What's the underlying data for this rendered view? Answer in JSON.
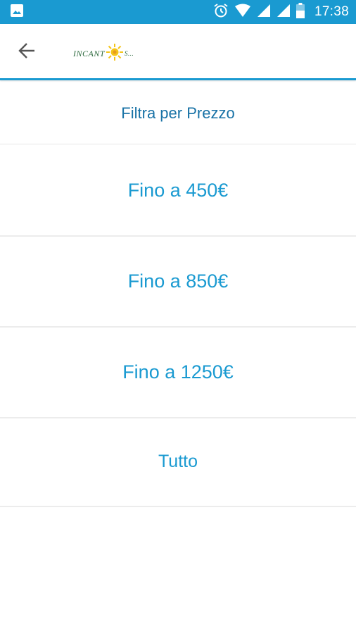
{
  "status_bar": {
    "time": "17:38",
    "icons": [
      "image-icon",
      "alarm-icon",
      "wifi-icon",
      "signal-icon",
      "signal-icon",
      "battery-icon"
    ]
  },
  "app_bar": {
    "back_icon": "arrow-left-icon",
    "logo_text": "INCANT",
    "logo_suffix": "S...",
    "colors": {
      "accent": "#1a9ad1",
      "logo_text": "#2d6a3e",
      "sun": "#f5c518"
    }
  },
  "filter": {
    "title": "Filtra per Prezzo",
    "options": [
      {
        "label": "Fino a 450€"
      },
      {
        "label": "Fino a 850€"
      },
      {
        "label": "Fino a 1250€"
      },
      {
        "label": "Tutto"
      }
    ]
  },
  "colors": {
    "status_bar": "#1a9ad1",
    "title_text": "#1872a6",
    "option_text": "#1a9ad1",
    "divider": "#ececec"
  }
}
